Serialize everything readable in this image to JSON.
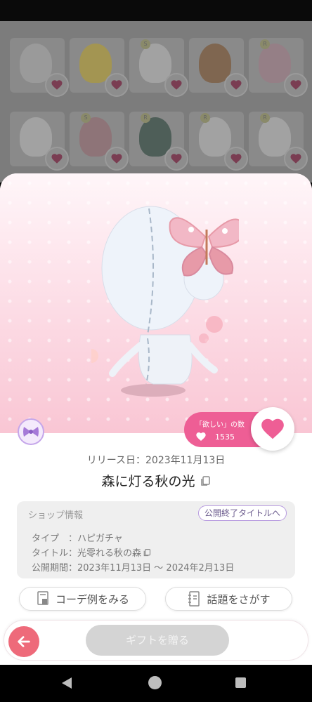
{
  "background_grid": {
    "items": [
      {
        "name": "sparkle-item",
        "thumb_color": "#9a9a9a",
        "badge": ""
      },
      {
        "name": "bird-item",
        "thumb_color": "#a39552",
        "badge": ""
      },
      {
        "name": "face-item",
        "thumb_color": "#a2a2a2",
        "badge": "S"
      },
      {
        "name": "cake-hat-item",
        "thumb_color": "#7f6650",
        "badge": ""
      },
      {
        "name": "ribbon-hair-item",
        "thumb_color": "#957f86",
        "badge": "R"
      },
      {
        "name": "bow-body-item",
        "thumb_color": "#a2a2a2",
        "badge": ""
      },
      {
        "name": "twin-tail-item",
        "thumb_color": "#8e7478",
        "badge": "S"
      },
      {
        "name": "green-hair-item",
        "thumb_color": "#4e5e58",
        "badge": "R"
      },
      {
        "name": "blank-head-item",
        "thumb_color": "#a2a2a2",
        "badge": "R"
      },
      {
        "name": "blank-head-item-2",
        "thumb_color": "#a2a2a2",
        "badge": "R"
      }
    ]
  },
  "item": {
    "release_date": "リリース日：2023年11月13日",
    "title": "森に灯る秋の光"
  },
  "wish": {
    "label": "「欲しい」の数",
    "count": "1535"
  },
  "shop": {
    "heading": "ショップ情報",
    "end_title_button": "公開終了タイトルへ",
    "type_row": "タイプ　：ハピガチャ",
    "title_row": "タイトル：光零れる秋の森",
    "period_row": "公開期間：2023年11月13日 〜 2024年2月13日"
  },
  "actions": {
    "coordinate_examples": "コーデ例をみる",
    "find_topics": "話題をさがす"
  },
  "bottom": {
    "gift_button": "ギフトを贈る"
  },
  "colors": {
    "accent_pink": "#ee5e95",
    "back_red": "#ee6a7a",
    "bow_purple": "#a67ad8"
  }
}
